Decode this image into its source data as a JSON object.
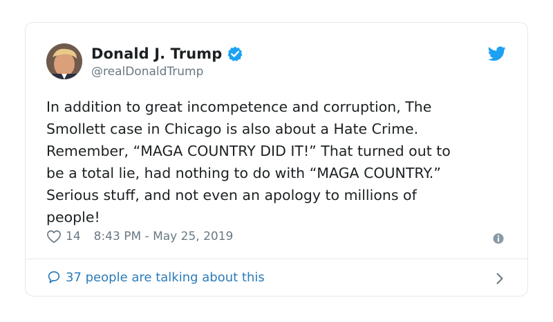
{
  "author": {
    "name": "Donald J. Trump",
    "handle": "@realDonaldTrump",
    "verified": true,
    "verified_color": "#1da1f2",
    "avatar_icon": "profile-photo"
  },
  "brand": {
    "icon": "twitter-bird-icon",
    "color": "#1da1f2"
  },
  "tweet": {
    "text": "In addition to great incompetence and corruption, The\nSmollett case in Chicago is also about a Hate Crime.\nRemember, “MAGA COUNTRY DID IT!” That turned out to\nbe a total lie, had nothing to do with “MAGA COUNTRY.”\nSerious stuff, and not even an apology to millions of\npeople!",
    "like_count": "14",
    "timestamp": "8:43 PM - May 25, 2019"
  },
  "footer": {
    "talking_text": "37 people are talking about this",
    "link_color": "#2b7bb9"
  },
  "colors": {
    "text": "#1c2022",
    "secondary": "#697882",
    "border": "#e1e8ed"
  }
}
